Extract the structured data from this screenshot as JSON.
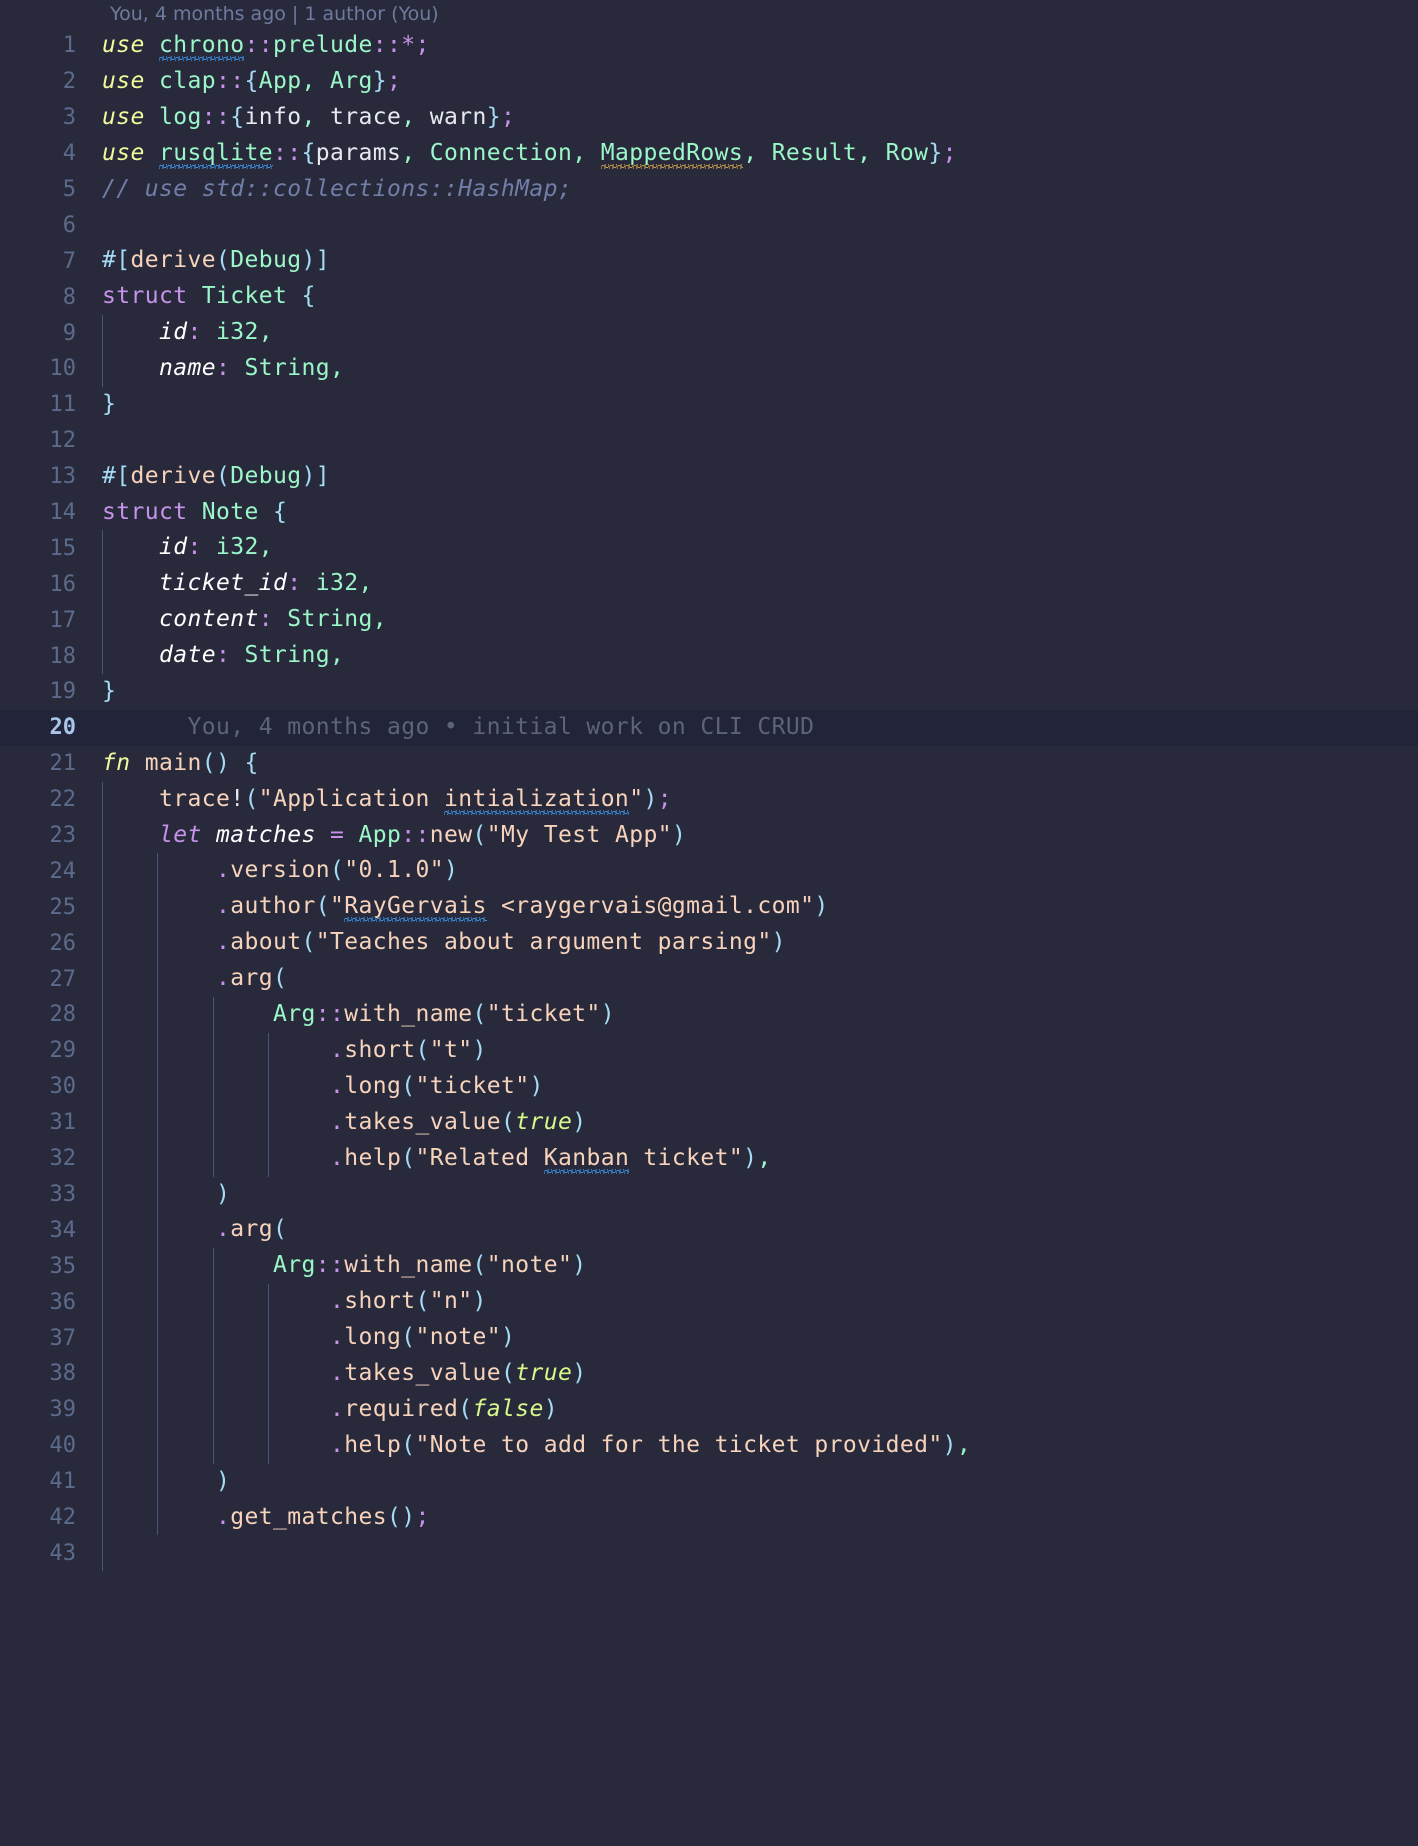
{
  "editor": {
    "theme_background": "#282a3c",
    "blame_header": "You, 4 months ago | 1 author (You)",
    "current_line_number": 20,
    "current_line_blame": "You, 4 months ago • initial work on CLI CRUD",
    "first_line": 1,
    "last_line": 43,
    "language": "rust",
    "colors": {
      "background": "#282a3c",
      "blame_row_background": "#22243a",
      "gutter_text": "#5c6b8a",
      "active_gutter_text": "#a9c6e8",
      "keyword": "#f1fa9c",
      "keyword_alt": "#c792ea",
      "type": "#9bf6c8",
      "string": "#f7d3bb",
      "comment": "#717fa8",
      "punctuation": "#c792ea",
      "bracket": "#a5dcf5",
      "boolean": "#d7f98a",
      "squiggle_info": "#3b8fe0",
      "squiggle_warning": "#c49a4a",
      "indent_guide": "#4a5278"
    }
  },
  "lines": [
    {
      "n": 1,
      "indent": 0,
      "text": "use chrono::prelude::*;"
    },
    {
      "n": 2,
      "indent": 0,
      "text": "use clap::{App, Arg};"
    },
    {
      "n": 3,
      "indent": 0,
      "text": "use log::{info, trace, warn};"
    },
    {
      "n": 4,
      "indent": 0,
      "text": "use rusqlite::{params, Connection, MappedRows, Result, Row};"
    },
    {
      "n": 5,
      "indent": 0,
      "text": "// use std::collections::HashMap;"
    },
    {
      "n": 6,
      "indent": 0,
      "text": ""
    },
    {
      "n": 7,
      "indent": 0,
      "text": "#[derive(Debug)]"
    },
    {
      "n": 8,
      "indent": 0,
      "text": "struct Ticket {"
    },
    {
      "n": 9,
      "indent": 1,
      "text": "    id: i32,"
    },
    {
      "n": 10,
      "indent": 1,
      "text": "    name: String,"
    },
    {
      "n": 11,
      "indent": 0,
      "text": "}"
    },
    {
      "n": 12,
      "indent": 0,
      "text": ""
    },
    {
      "n": 13,
      "indent": 0,
      "text": "#[derive(Debug)]"
    },
    {
      "n": 14,
      "indent": 0,
      "text": "struct Note {"
    },
    {
      "n": 15,
      "indent": 1,
      "text": "    id: i32,"
    },
    {
      "n": 16,
      "indent": 1,
      "text": "    ticket_id: i32,"
    },
    {
      "n": 17,
      "indent": 1,
      "text": "    content: String,"
    },
    {
      "n": 18,
      "indent": 1,
      "text": "    date: String,"
    },
    {
      "n": 19,
      "indent": 0,
      "text": "}"
    },
    {
      "n": 20,
      "indent": 0,
      "text": "You, 4 months ago • initial work on CLI CRUD",
      "is_blame": true
    },
    {
      "n": 21,
      "indent": 0,
      "text": "fn main() {"
    },
    {
      "n": 22,
      "indent": 1,
      "text": "    trace!(\"Application intialization\");"
    },
    {
      "n": 23,
      "indent": 1,
      "text": "    let matches = App::new(\"My Test App\")"
    },
    {
      "n": 24,
      "indent": 2,
      "text": "        .version(\"0.1.0\")"
    },
    {
      "n": 25,
      "indent": 2,
      "text": "        .author(\"RayGervais <raygervais@gmail.com\")"
    },
    {
      "n": 26,
      "indent": 2,
      "text": "        .about(\"Teaches about argument parsing\")"
    },
    {
      "n": 27,
      "indent": 2,
      "text": "        .arg("
    },
    {
      "n": 28,
      "indent": 3,
      "text": "            Arg::with_name(\"ticket\")"
    },
    {
      "n": 29,
      "indent": 4,
      "text": "                .short(\"t\")"
    },
    {
      "n": 30,
      "indent": 4,
      "text": "                .long(\"ticket\")"
    },
    {
      "n": 31,
      "indent": 4,
      "text": "                .takes_value(true)"
    },
    {
      "n": 32,
      "indent": 4,
      "text": "                .help(\"Related Kanban ticket\"),"
    },
    {
      "n": 33,
      "indent": 2,
      "text": "        )"
    },
    {
      "n": 34,
      "indent": 2,
      "text": "        .arg("
    },
    {
      "n": 35,
      "indent": 3,
      "text": "            Arg::with_name(\"note\")"
    },
    {
      "n": 36,
      "indent": 4,
      "text": "                .short(\"n\")"
    },
    {
      "n": 37,
      "indent": 4,
      "text": "                .long(\"note\")"
    },
    {
      "n": 38,
      "indent": 4,
      "text": "                .takes_value(true)"
    },
    {
      "n": 39,
      "indent": 4,
      "text": "                .required(false)"
    },
    {
      "n": 40,
      "indent": 4,
      "text": "                .help(\"Note to add for the ticket provided\"),"
    },
    {
      "n": 41,
      "indent": 2,
      "text": "        )"
    },
    {
      "n": 42,
      "indent": 2,
      "text": "        .get_matches();"
    },
    {
      "n": 43,
      "indent": 1,
      "text": ""
    }
  ],
  "diagnostics": [
    {
      "line": 1,
      "token": "chrono",
      "severity": "info"
    },
    {
      "line": 4,
      "token": "rusqlite",
      "severity": "info"
    },
    {
      "line": 4,
      "token": "MappedRows",
      "severity": "warning"
    },
    {
      "line": 22,
      "token": "intialization",
      "severity": "info"
    },
    {
      "line": 25,
      "token": "RayGervais",
      "severity": "info"
    },
    {
      "line": 32,
      "token": "Kanban",
      "severity": "info"
    }
  ]
}
